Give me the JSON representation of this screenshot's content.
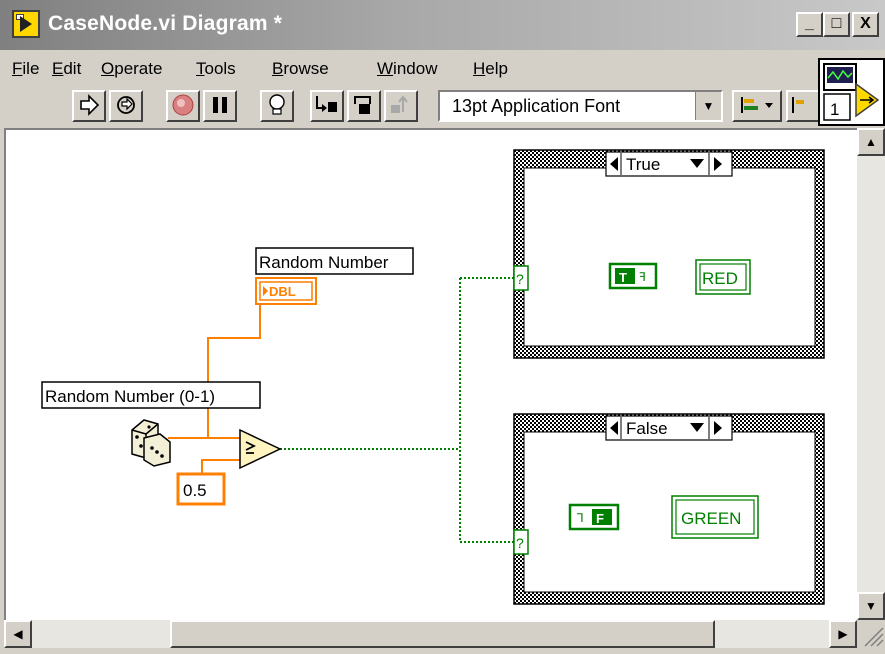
{
  "window": {
    "title": "CaseNode.vi Diagram *"
  },
  "title_buttons": {
    "minimize": "_",
    "maximize": "□",
    "close": "X"
  },
  "menu": [
    {
      "label": "File",
      "key": "F",
      "rest": "ile"
    },
    {
      "label": "Edit",
      "key": "E",
      "rest": "dit"
    },
    {
      "label": "Operate",
      "key": "O",
      "rest": "perate"
    },
    {
      "label": "Tools",
      "key": "T",
      "rest": "ools"
    },
    {
      "label": "Browse",
      "key": "B",
      "rest": "rowse"
    },
    {
      "label": "Window",
      "key": "W",
      "rest": "indow"
    },
    {
      "label": "Help",
      "key": "H",
      "rest": "elp"
    }
  ],
  "toolbar": {
    "font_label": "13pt Application Font"
  },
  "connector_pane": {
    "label": "1"
  },
  "diagram": {
    "random_indicator_label": "Random Number",
    "random_indicator_type": "DBL",
    "random_function_label": "Random Number (0-1)",
    "constant_value": "0.5",
    "case_true": {
      "selector": "True",
      "bool_constant": "T",
      "string_indicator": "RED",
      "terminal": "?"
    },
    "case_false": {
      "selector": "False",
      "bool_constant": "F",
      "string_indicator": "GREEN",
      "terminal": "?"
    }
  },
  "colors": {
    "wire_numeric": "#ff7f00",
    "wire_boolean": "#008000",
    "bool_green": "#007f00",
    "compare_fill": "#fff4c0",
    "titlebar_start": "#808080"
  }
}
